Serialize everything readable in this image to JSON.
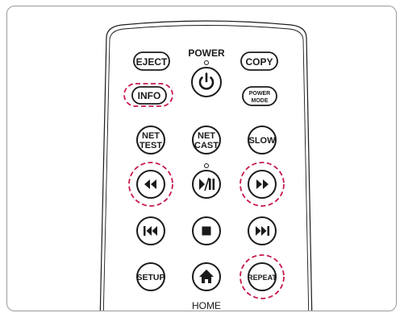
{
  "highlight_color": "#c8194a",
  "remote_body_color": "#ffffff",
  "outline_color": "#1a1a1a",
  "labels": {
    "power": "POWER",
    "eject": "EJECT",
    "copy": "COPY",
    "info": "INFO",
    "power_mode_line1": "POWER",
    "power_mode_line2": "MODE",
    "net_test_line1": "NET",
    "net_test_line2": "TEST",
    "net_cast_line1": "NET",
    "net_cast_line2": "CAST",
    "slow": "SLOW",
    "setup": "SETUP",
    "repeat": "REPEAT",
    "home": "HOME"
  },
  "icons": {
    "power": "power-icon",
    "rewind": "rewind-icon",
    "play_pause": "play-pause-icon",
    "fast_forward": "fast-forward-icon",
    "skip_back": "skip-back-icon",
    "stop": "stop-icon",
    "skip_forward": "skip-forward-icon",
    "home": "home-icon"
  },
  "highlighted_buttons": [
    "INFO",
    "rewind",
    "fast-forward",
    "REPEAT"
  ]
}
